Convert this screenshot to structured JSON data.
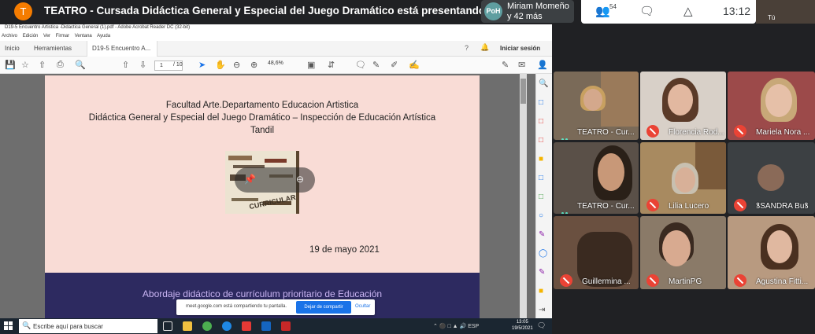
{
  "meet": {
    "presenter_initial": "T",
    "presentation_title": "TEATRO - Cursada Didáctica General y Especial del Juego Dramático está presentando",
    "people_avatar": "PoH",
    "people_line1": "Miriam Momeño",
    "people_line2": "y 42 más",
    "participants_count": "54",
    "clock": "13:12",
    "self_label": "Tú"
  },
  "acrobat": {
    "window_title": "D19-5 Encuentro Artistica -Didactica General (1).pdf - Adobe Acrobat Reader DC (32-bit)",
    "menu": [
      "Archivo",
      "Edición",
      "Ver",
      "Firmar",
      "Ventana",
      "Ayuda"
    ],
    "tabs": {
      "home": "Inicio",
      "tools": "Herramientas",
      "doc": "D19-5 Encuentro A..."
    },
    "signin": "Iniciar sesión",
    "page_current": "1",
    "page_total": "/ 10",
    "zoom": "48,6%"
  },
  "slide": {
    "line1": "Facultad Arte.Departamento Educacion Artistica",
    "line2": "Didáctica General y Especial del Juego Dramático – Inspección de Educación Artística",
    "line3": "Tandil",
    "date": "19 de mayo  2021",
    "band_text": "Abordaje didáctico de currículum prioritario de Educación",
    "book_word": "CURRICULAR"
  },
  "share_notice": {
    "message": "meet.google.com está compartiendo tu pantalla.",
    "stop": "Dejar de compartir",
    "hide": "Ocultar"
  },
  "taskbar": {
    "search_placeholder": "Escribe aquí para buscar",
    "lang": "ESP",
    "time": "13:05",
    "date": "19/5/2021"
  },
  "participants": [
    {
      "name": "TEATRO - Cur...",
      "mic": "active"
    },
    {
      "name": "Florencia Rod...",
      "mic": "muted"
    },
    {
      "name": "Mariela Nora ...",
      "mic": "muted"
    },
    {
      "name": "TEATRO - Cur...",
      "mic": "active"
    },
    {
      "name": "Lilia Lucero",
      "mic": "muted"
    },
    {
      "name": "ꝸSANDRA Buꝸ",
      "mic": "muted"
    },
    {
      "name": "Guillermina ...",
      "mic": "muted"
    },
    {
      "name": "MartinPG",
      "mic": "muted"
    },
    {
      "name": "Agustina Fitti...",
      "mic": "muted"
    }
  ]
}
